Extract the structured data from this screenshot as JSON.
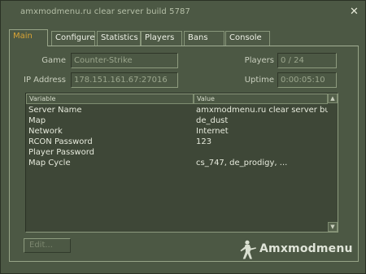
{
  "window": {
    "title": "amxmodmenu.ru clear server build 5787",
    "close_glyph": "✕"
  },
  "tabs": [
    {
      "label": "Main",
      "active": true
    },
    {
      "label": "Configure",
      "active": false
    },
    {
      "label": "Statistics",
      "active": false
    },
    {
      "label": "Players",
      "active": false
    },
    {
      "label": "Bans",
      "active": false
    },
    {
      "label": "Console",
      "active": false
    }
  ],
  "info": {
    "game_label": "Game",
    "game_value": "Counter-Strike",
    "ip_label": "IP Address",
    "ip_value": "178.151.161.67:27016",
    "players_label": "Players",
    "players_value": "0 / 24",
    "uptime_label": "Uptime",
    "uptime_value": "0:00:05:10"
  },
  "table": {
    "columns": [
      "Variable",
      "Value"
    ],
    "rows": [
      {
        "variable": "Server Name",
        "value": "amxmodmenu.ru clear server build ..."
      },
      {
        "variable": "Map",
        "value": "de_dust"
      },
      {
        "variable": "Network",
        "value": "Internet"
      },
      {
        "variable": "RCON Password",
        "value": "123"
      },
      {
        "variable": "Player Password",
        "value": ""
      },
      {
        "variable": "Map Cycle",
        "value": "cs_747, de_prodigy, ..."
      }
    ],
    "scroll_up_glyph": "▲",
    "scroll_down_glyph": "▼"
  },
  "footer": {
    "edit_label": "Edit...",
    "brand_name": "Amxmodmenu"
  },
  "colors": {
    "background": "#4c5844",
    "active_tab_text": "#d8a335",
    "list_background": "#3e4737"
  }
}
